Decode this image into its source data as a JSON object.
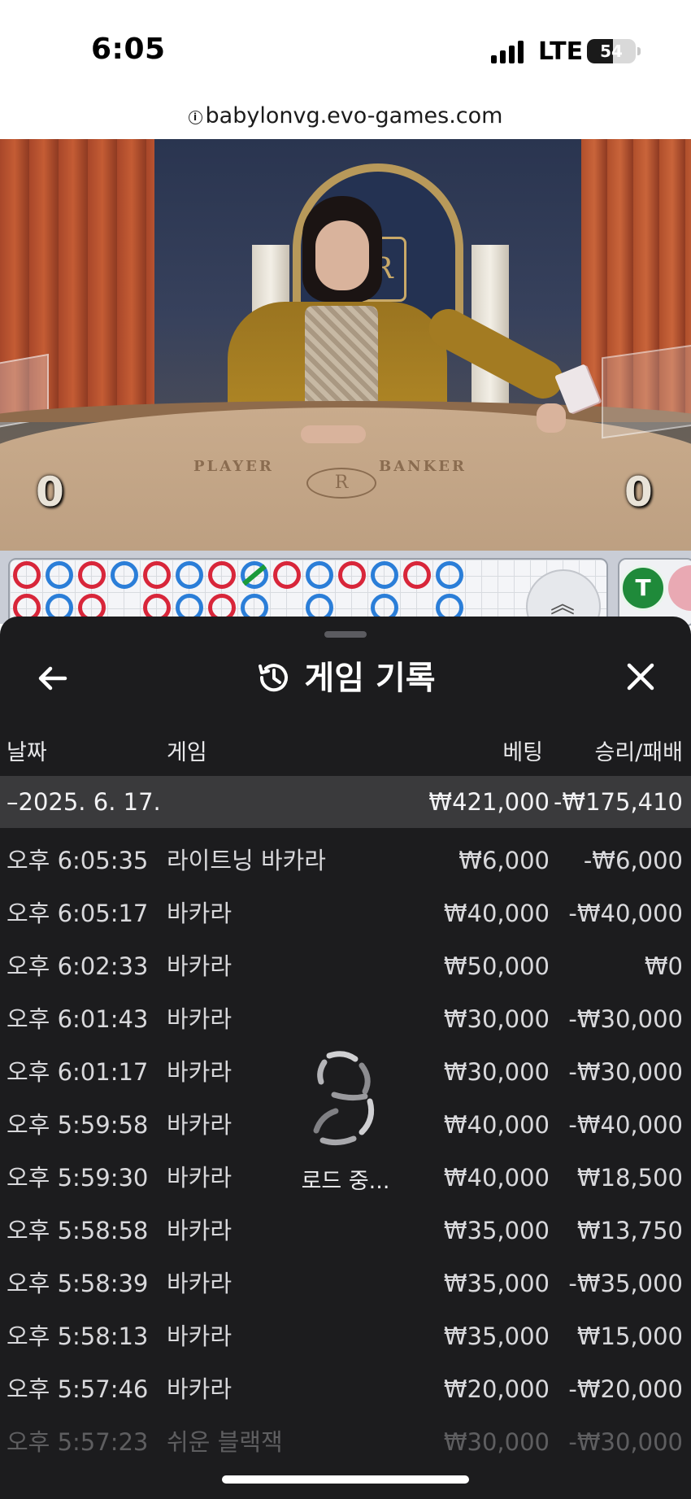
{
  "status_bar": {
    "time": "6:05",
    "network": "LTE",
    "battery": "54",
    "battery_level": 0.54,
    "signal_icon": "cellular-signal-icon",
    "battery_icon": "battery-icon"
  },
  "browser": {
    "url": "babylonvg.evo-games.com",
    "info_icon": "info-icon"
  },
  "video": {
    "player_label": "PLAYER",
    "banker_label": "BANKER",
    "player_score": "0",
    "banker_score": "0",
    "logo_letter": "R",
    "crest_letter": "R"
  },
  "roads": {
    "tie_label": "T",
    "expand_icon": "chevron-up-double-icon",
    "colors": {
      "player": "#2b7ed8",
      "banker": "#d8263a",
      "tie": "#1a9a3a"
    }
  },
  "history": {
    "title": "게임 기록",
    "back_icon": "arrow-left-icon",
    "history_icon": "history-clock-icon",
    "close_icon": "close-icon",
    "columns": {
      "date": "날짜",
      "game": "게임",
      "bet": "베팅",
      "result": "승리/패배"
    },
    "summary": {
      "date": "–2025. 6. 17.",
      "bet": "₩421,000",
      "result": "-₩175,410"
    },
    "rows": [
      {
        "time": "오후 6:05:35",
        "game": "라이트닝 바카라",
        "bet": "₩6,000",
        "result": "-₩6,000"
      },
      {
        "time": "오후 6:05:17",
        "game": "바카라",
        "bet": "₩40,000",
        "result": "-₩40,000"
      },
      {
        "time": "오후 6:02:33",
        "game": "바카라",
        "bet": "₩50,000",
        "result": "₩0"
      },
      {
        "time": "오후 6:01:43",
        "game": "바카라",
        "bet": "₩30,000",
        "result": "-₩30,000"
      },
      {
        "time": "오후 6:01:17",
        "game": "바카라",
        "bet": "₩30,000",
        "result": "-₩30,000"
      },
      {
        "time": "오후 5:59:58",
        "game": "바카라",
        "bet": "₩40,000",
        "result": "-₩40,000"
      },
      {
        "time": "오후 5:59:30",
        "game": "바카라",
        "bet": "₩40,000",
        "result": "₩18,500"
      },
      {
        "time": "오후 5:58:58",
        "game": "바카라",
        "bet": "₩35,000",
        "result": "₩13,750"
      },
      {
        "time": "오후 5:58:39",
        "game": "바카라",
        "bet": "₩35,000",
        "result": "-₩35,000"
      },
      {
        "time": "오후 5:58:13",
        "game": "바카라",
        "bet": "₩35,000",
        "result": "₩15,000"
      },
      {
        "time": "오후 5:57:46",
        "game": "바카라",
        "bet": "₩20,000",
        "result": "-₩20,000"
      },
      {
        "time": "오후 5:57:23",
        "game": "쉬운 블랙잭",
        "bet": "₩30,000",
        "result": "-₩30,000"
      }
    ],
    "loading_text": "로드 중...",
    "loading_icon": "loading-spinner-icon"
  }
}
